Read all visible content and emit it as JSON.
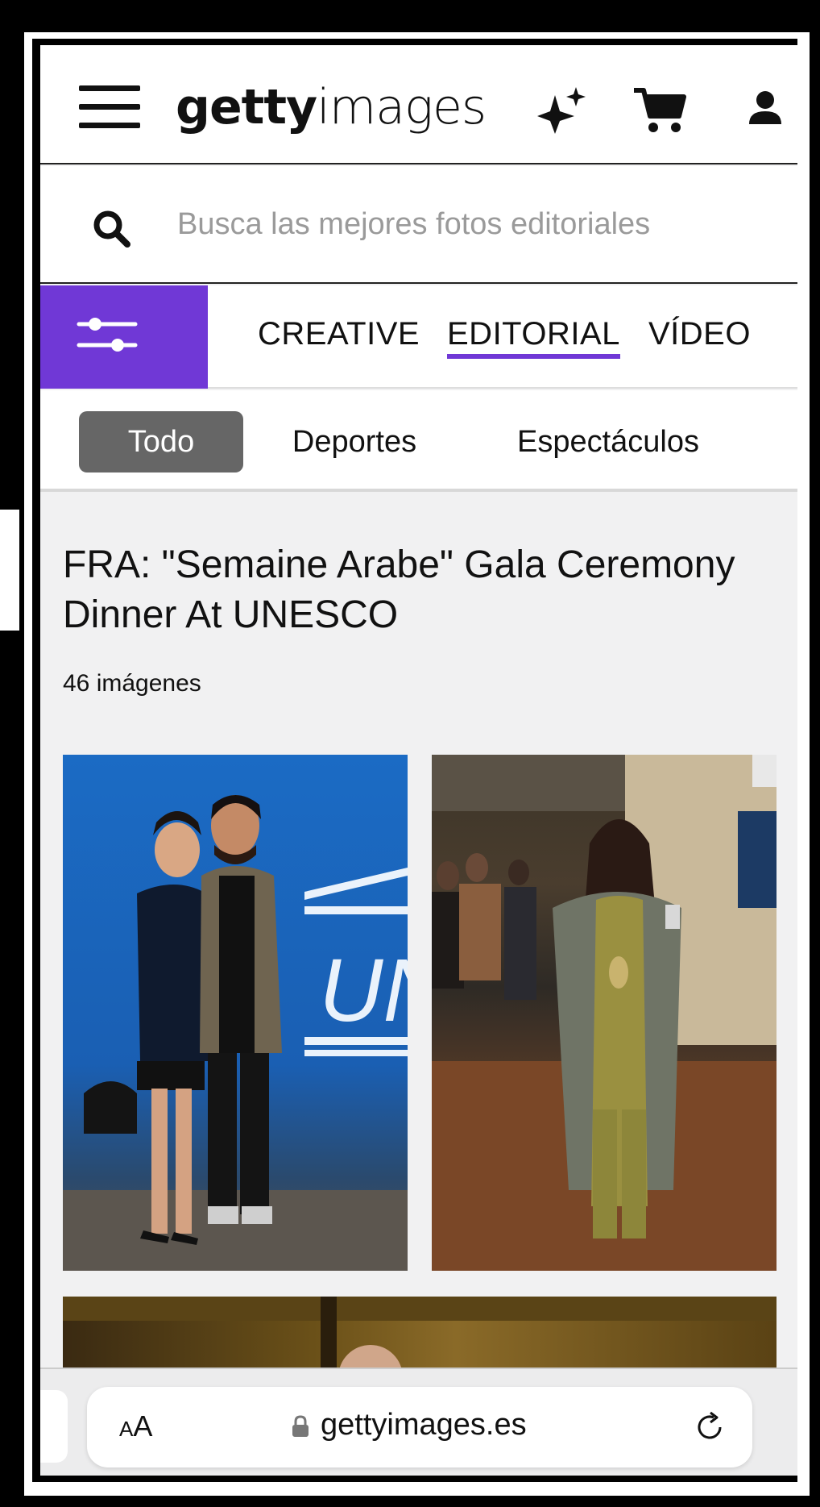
{
  "header": {
    "logo_bold": "getty",
    "logo_light": "images",
    "icons": [
      "hamburger-menu-icon",
      "sparkle-icon",
      "cart-icon",
      "account-icon"
    ]
  },
  "search": {
    "placeholder": "Busca las mejores fotos editoriales"
  },
  "tabs": [
    {
      "label": "CREATIVE",
      "active": false
    },
    {
      "label": "EDITORIAL",
      "active": true
    },
    {
      "label": "VÍDEO",
      "active": false
    }
  ],
  "categories": [
    {
      "label": "Todo",
      "active": true
    },
    {
      "label": "Deportes",
      "active": false
    },
    {
      "label": "Espectáculos",
      "active": false
    }
  ],
  "event": {
    "title": "FRA: \"Semaine Arabe\" Gala Ceremony Dinner At UNESCO",
    "count": "46 imágenes"
  },
  "photo_text": {
    "backdrop_letters": "UNE"
  },
  "browser": {
    "text_size_small": "A",
    "text_size_big": "A",
    "url": "gettyimages.es"
  },
  "colors": {
    "accent": "#7038d6",
    "active_pill": "#666666"
  }
}
